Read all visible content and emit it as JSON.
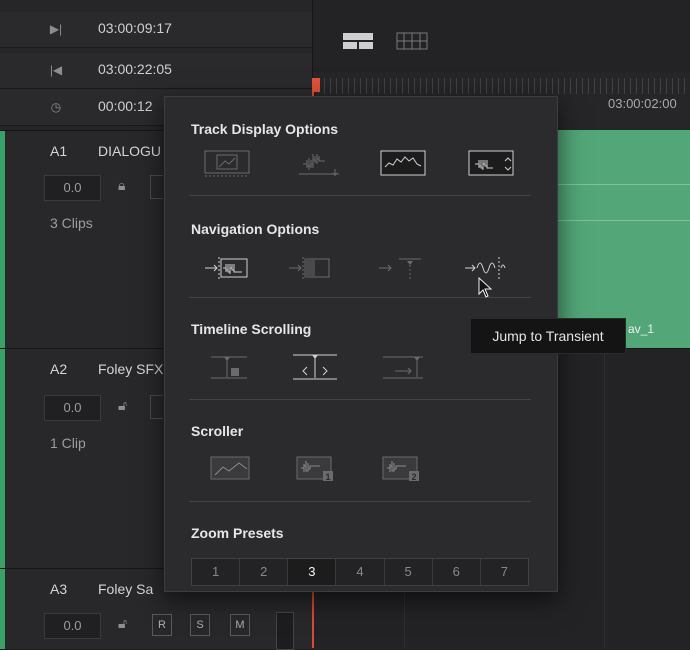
{
  "timecodes": [
    {
      "icon": "play-to-end-icon",
      "value": "03:00:09:17"
    },
    {
      "icon": "skip-back-icon",
      "value": "03:00:22:05"
    },
    {
      "icon": "clock-icon",
      "value": "00:00:12"
    }
  ],
  "ruler": {
    "timecode": "03:00:02:00"
  },
  "tracks": [
    {
      "id": "A1",
      "name": "DIALOGU",
      "volume": "0.0",
      "clips": "3 Clips"
    },
    {
      "id": "A2",
      "name": "Foley SFX",
      "volume": "0.0",
      "clips": "1 Clip"
    },
    {
      "id": "A3",
      "name": "Foley Sa",
      "volume": "0.0",
      "buttons": [
        "R",
        "S",
        "M"
      ]
    }
  ],
  "clip": {
    "name": "av_1",
    "color": "#52a678"
  },
  "popup": {
    "track_display": {
      "title": "Track Display Options"
    },
    "navigation": {
      "title": "Navigation Options"
    },
    "scrolling": {
      "title": "Timeline Scrolling"
    },
    "scroller": {
      "title": "Scroller"
    },
    "zoom": {
      "title": "Zoom Presets",
      "presets": [
        "1",
        "2",
        "3",
        "4",
        "5",
        "6",
        "7"
      ],
      "selected": "3"
    }
  },
  "tooltip": "Jump to Transient",
  "colors": {
    "accent_green": "#52a678",
    "playhead": "#d94a36"
  }
}
